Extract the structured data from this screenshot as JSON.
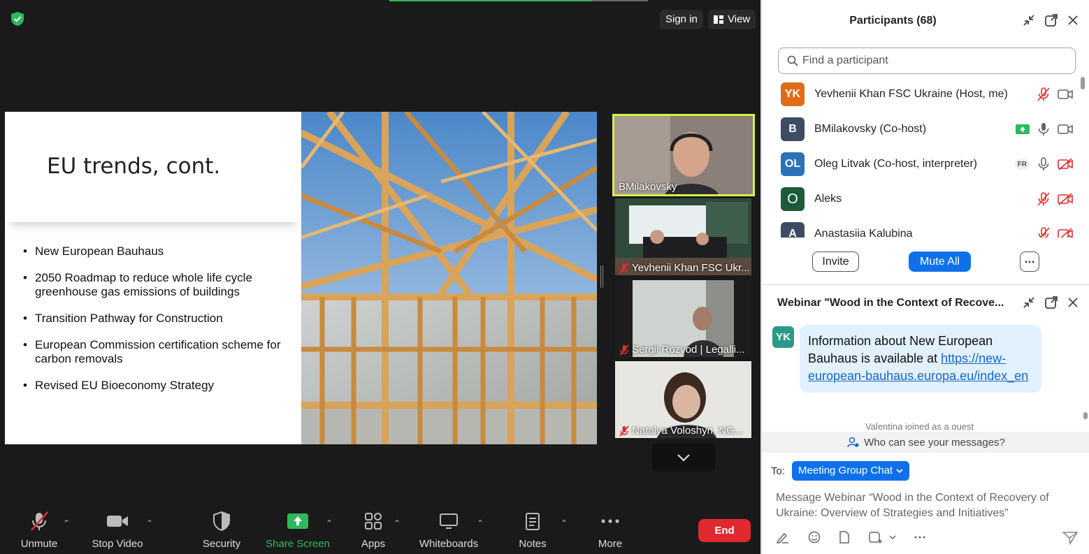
{
  "colors": {
    "accent": "#0e71eb",
    "end": "#e0292e",
    "active_speaker": "#d6f04a",
    "muted": "#e02e2e",
    "screen_share": "#2eb85c"
  },
  "top_bar": {
    "sign_in": "Sign in",
    "view": "View"
  },
  "slide": {
    "title": "EU trends, cont.",
    "bullets": [
      "New European Bauhaus",
      "2050 Roadmap to reduce whole life cycle greenhouse gas emissions of buildings",
      "Transition Pathway for Construction",
      "European Commission certification scheme for carbon removals",
      "Revised EU Bioeconomy Strategy"
    ]
  },
  "thumbnails": [
    {
      "name": "BMilakovsky",
      "muted": false
    },
    {
      "name": "Yevhenii Khan FSC Ukr...",
      "muted": true
    },
    {
      "name": "Sergii Rozvod | Legalli...",
      "muted": true
    },
    {
      "name": "Natalya Voloshyn, NG...",
      "muted": true
    }
  ],
  "toolbar": {
    "unmute": "Unmute",
    "stop_video": "Stop Video",
    "security": "Security",
    "share_screen": "Share Screen",
    "apps": "Apps",
    "whiteboards": "Whiteboards",
    "notes": "Notes",
    "more": "More",
    "end": "End"
  },
  "participants": {
    "title": "Participants (68)",
    "search_placeholder": "Find a participant",
    "list": [
      {
        "initials": "YK",
        "color": "#e06c1a",
        "name": "Yevhenii Khan FSC Ukraine (Host, me)",
        "badge": "",
        "mic": "muted",
        "video": "on"
      },
      {
        "initials": "B",
        "color": "#3d4b63",
        "name": "BMilakovsky (Co-host)",
        "badge": "share",
        "mic": "on",
        "video": "on"
      },
      {
        "initials": "OL",
        "color": "#2c72b8",
        "name": "Oleg Litvak (Co-host, interpreter)",
        "badge": "FR",
        "mic": "on",
        "video": "off"
      },
      {
        "initials": "O",
        "color": "#1c5a3a",
        "name": "Aleks",
        "badge": "",
        "mic": "muted",
        "video": "off"
      },
      {
        "initials": "A",
        "color": "#3d4b63",
        "name": "Anastasiia Kalubina",
        "badge": "",
        "mic": "muted",
        "video": "off"
      }
    ],
    "invite": "Invite",
    "mute_all": "Mute All"
  },
  "chat": {
    "title": "Webinar \"Wood in the Context of Recove...",
    "sender_initials": "YK",
    "message_text": "Information about New European Bauhaus is available at ",
    "message_link": "https://new-european-bauhaus.europa.eu/index_en",
    "system_note": "Valentina joined as a guest",
    "who_can_see": "Who can see your messages?",
    "to_label": "To:",
    "to_target": "Meeting Group Chat",
    "input_placeholder": "Message Webinar “Wood in the Context of Recovery of Ukraine: Overview of Strategies and Initiatives”"
  }
}
